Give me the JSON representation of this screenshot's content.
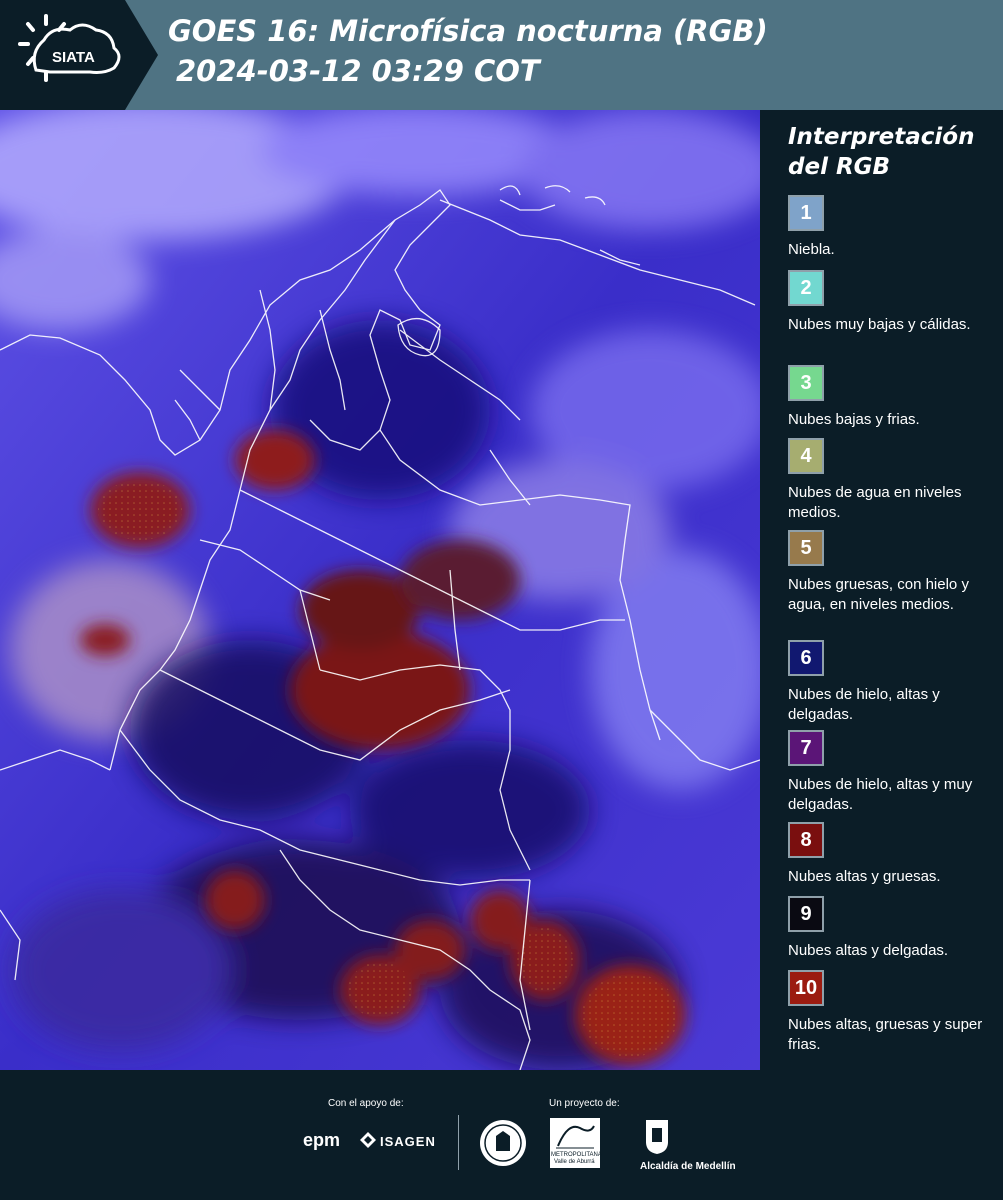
{
  "header": {
    "logo_text": "SIATA",
    "title_line1": "GOES 16: Microfísica nocturna (RGB)",
    "title_line2": "2024-03-12 03:29 COT"
  },
  "sidebar": {
    "title": "Interpretación del RGB",
    "items": [
      {
        "num": "1",
        "label": "Niebla.",
        "color": "#7fa3c9"
      },
      {
        "num": "2",
        "label": "Nubes muy bajas y cálidas.",
        "color": "#72d8d0"
      },
      {
        "num": "3",
        "label": "Nubes bajas y frias.",
        "color": "#76d88f"
      },
      {
        "num": "4",
        "label": "Nubes de agua en niveles medios.",
        "color": "#a6ad70"
      },
      {
        "num": "5",
        "label": "Nubes gruesas, con hielo y agua, en niveles medios.",
        "color": "#977a4c"
      },
      {
        "num": "6",
        "label": "Nubes de hielo, altas y delgadas.",
        "color": "#111870"
      },
      {
        "num": "7",
        "label": "Nubes de hielo, altas y muy delgadas.",
        "color": "#5b1577"
      },
      {
        "num": "8",
        "label": "Nubes altas y gruesas.",
        "color": "#7a0f0f"
      },
      {
        "num": "9",
        "label": "Nubes altas y delgadas.",
        "color": "#0a0a12"
      },
      {
        "num": "10",
        "label": "Nubes altas, gruesas y super frias.",
        "color": "#9b1b10"
      }
    ]
  },
  "footer": {
    "support_label": "Con el apoyo de:",
    "project_label": "Un proyecto de:",
    "epm": "epm",
    "isagen": "ISAGEN",
    "metro_line1": "METROPOLITANA",
    "metro_line2": "Valle de Aburrá",
    "alcaldia": "Alcaldía de Medellín"
  }
}
